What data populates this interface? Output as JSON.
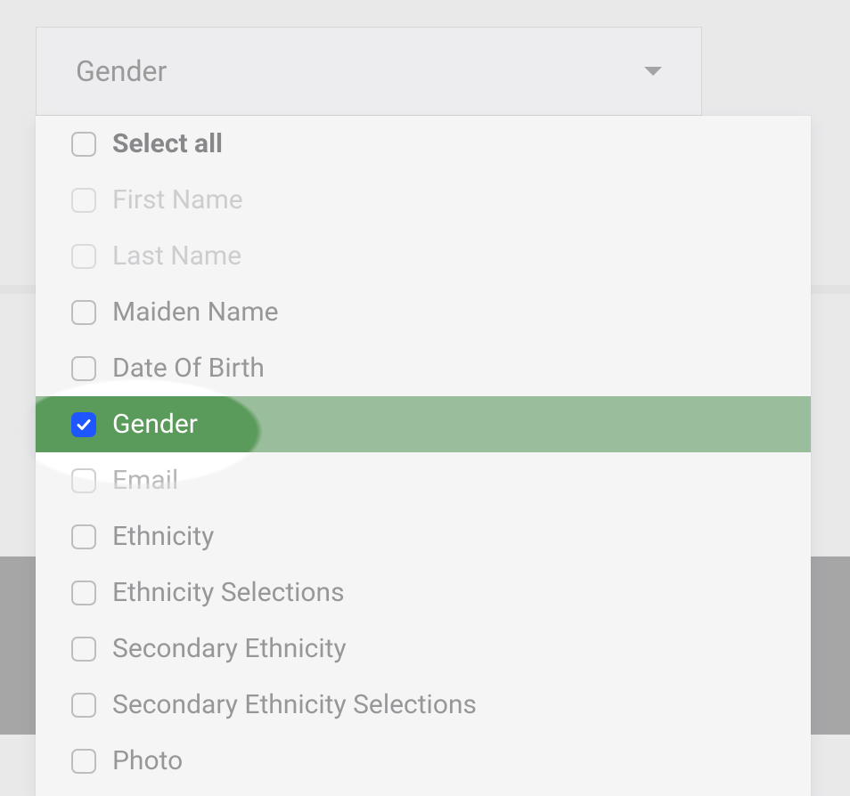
{
  "colors": {
    "highlight_bg": "#5a9a5a",
    "checked_bg": "#1e57ff"
  },
  "select": {
    "value": "Gender",
    "options": [
      {
        "label": "Select all",
        "bold": true,
        "disabled": false,
        "checked": false
      },
      {
        "label": "First Name",
        "bold": false,
        "disabled": true,
        "checked": false
      },
      {
        "label": "Last Name",
        "bold": false,
        "disabled": true,
        "checked": false
      },
      {
        "label": "Maiden Name",
        "bold": false,
        "disabled": false,
        "checked": false
      },
      {
        "label": "Date Of Birth",
        "bold": false,
        "disabled": false,
        "checked": false
      },
      {
        "label": "Gender",
        "bold": false,
        "disabled": false,
        "checked": true
      },
      {
        "label": "Email",
        "bold": false,
        "disabled": true,
        "checked": false
      },
      {
        "label": "Ethnicity",
        "bold": false,
        "disabled": false,
        "checked": false
      },
      {
        "label": "Ethnicity Selections",
        "bold": false,
        "disabled": false,
        "checked": false
      },
      {
        "label": "Secondary Ethnicity",
        "bold": false,
        "disabled": false,
        "checked": false
      },
      {
        "label": "Secondary Ethnicity Selections",
        "bold": false,
        "disabled": false,
        "checked": false
      },
      {
        "label": "Photo",
        "bold": false,
        "disabled": false,
        "checked": false
      }
    ]
  }
}
